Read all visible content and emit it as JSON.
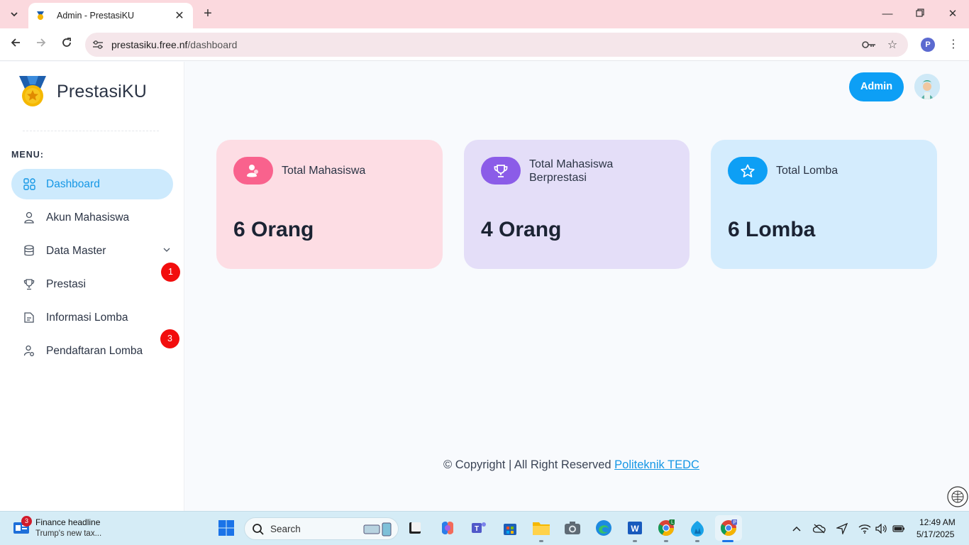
{
  "browser": {
    "tab_title": "Admin - PrestasiKU",
    "url_host": "prestasiku.free.nf",
    "url_path": "/dashboard",
    "profile_initial": "P"
  },
  "sidebar": {
    "brand": "PrestasiKU",
    "menu_label": "MENU:",
    "items": [
      {
        "label": "Dashboard",
        "icon": "grid-icon",
        "active": true
      },
      {
        "label": "Akun Mahasiswa",
        "icon": "user-icon"
      },
      {
        "label": "Data Master",
        "icon": "database-icon",
        "has_chevron": true
      },
      {
        "label": "Prestasi",
        "icon": "trophy-icon"
      },
      {
        "label": "Informasi Lomba",
        "icon": "document-icon"
      },
      {
        "label": "Pendaftaran Lomba",
        "icon": "user-settings-icon"
      }
    ],
    "badges": [
      "1",
      "3"
    ]
  },
  "header": {
    "role_button": "Admin"
  },
  "stats": [
    {
      "title": "Total Mahasiswa",
      "value": "6 Orang",
      "icon": "users-icon",
      "bg": "#fddde4",
      "accent": "#f9628d"
    },
    {
      "title": "Total Mahasiswa Berprestasi",
      "value": "4 Orang",
      "icon": "trophy-icon",
      "bg": "#e4def8",
      "accent": "#8b5ce8"
    },
    {
      "title": "Total Lomba",
      "value": "6 Lomba",
      "icon": "star-icon",
      "bg": "#d4ecfd",
      "accent": "#0d9ff5"
    }
  ],
  "footer": {
    "text": "© Copyright | All Right Reserved ",
    "link": "Politeknik TEDC"
  },
  "taskbar": {
    "widget_badge": "3",
    "widget_title": "Finance headline",
    "widget_subtitle": "Trump's new tax...",
    "search_placeholder": "Search",
    "time": "12:49 AM",
    "date": "5/17/2025",
    "chrome_profile_badges": [
      "L",
      "P"
    ]
  },
  "colors": {
    "accent": "#0d9ff5",
    "badge": "#f20d0d"
  }
}
